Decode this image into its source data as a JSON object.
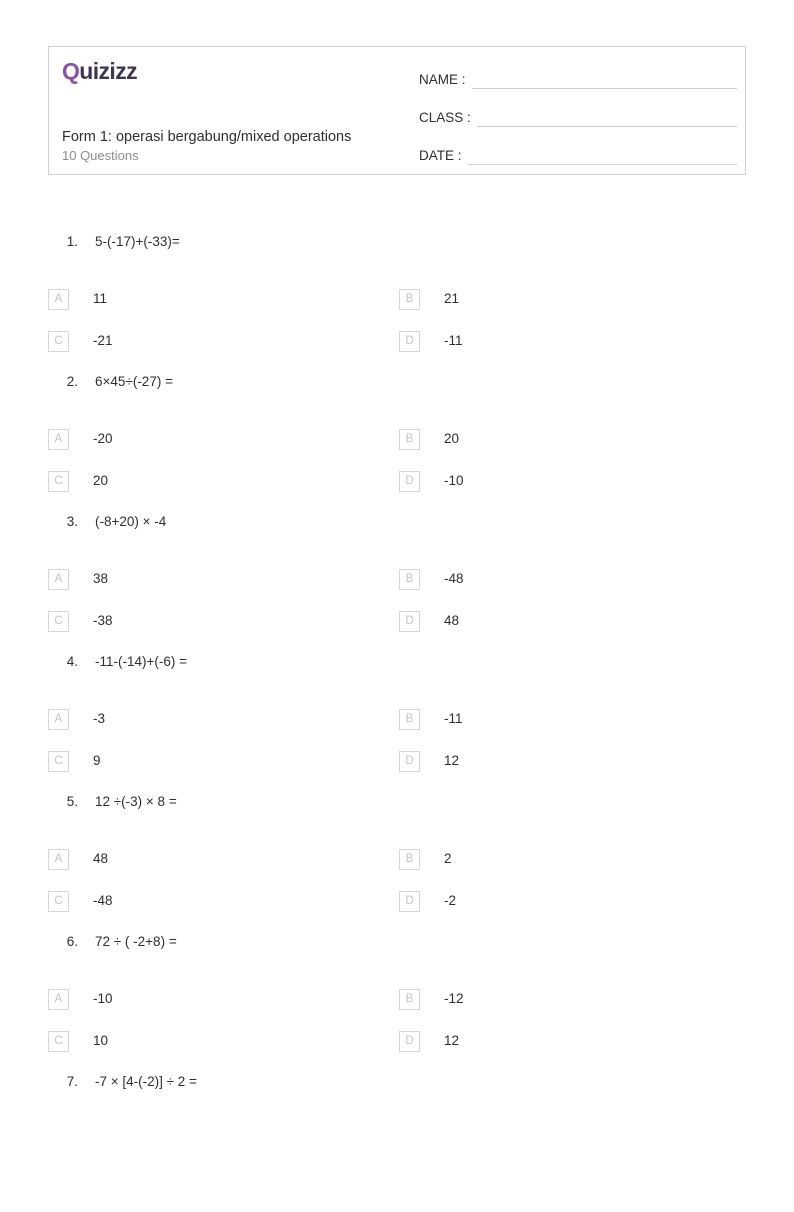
{
  "header": {
    "logo": {
      "first_letter": "Q",
      "rest": "uizizz",
      "accent_color": "#8854a0",
      "text_color": "#3f3551"
    },
    "title": "Form 1: operasi bergabung/mixed operations",
    "subtitle": "10 Questions",
    "fields": [
      {
        "label": "NAME :",
        "value": ""
      },
      {
        "label": "CLASS :",
        "value": ""
      },
      {
        "label": "DATE  :",
        "value": ""
      }
    ]
  },
  "questions": [
    {
      "number": "1.",
      "text": "5-(-17)+(-33)=",
      "options": [
        {
          "letter": "A",
          "text": "11"
        },
        {
          "letter": "B",
          "text": "21"
        },
        {
          "letter": "C",
          "text": "-21"
        },
        {
          "letter": "D",
          "text": "-11"
        }
      ]
    },
    {
      "number": "2.",
      "text": "6×45÷(-27) =",
      "options": [
        {
          "letter": "A",
          "text": "-20"
        },
        {
          "letter": "B",
          "text": "20"
        },
        {
          "letter": "C",
          "text": "20"
        },
        {
          "letter": "D",
          "text": "-10"
        }
      ]
    },
    {
      "number": "3.",
      "text": "(-8+20) × -4",
      "options": [
        {
          "letter": "A",
          "text": "38"
        },
        {
          "letter": "B",
          "text": "-48"
        },
        {
          "letter": "C",
          "text": "-38"
        },
        {
          "letter": "D",
          "text": "48"
        }
      ]
    },
    {
      "number": "4.",
      "text": "-11-(-14)+(-6) =",
      "options": [
        {
          "letter": "A",
          "text": "-3"
        },
        {
          "letter": "B",
          "text": "-11"
        },
        {
          "letter": "C",
          "text": "9"
        },
        {
          "letter": "D",
          "text": "12"
        }
      ]
    },
    {
      "number": "5.",
      "text": "12 ÷(-3) × 8 =",
      "options": [
        {
          "letter": "A",
          "text": "48"
        },
        {
          "letter": "B",
          "text": "2"
        },
        {
          "letter": "C",
          "text": "-48"
        },
        {
          "letter": "D",
          "text": "-2"
        }
      ]
    },
    {
      "number": "6.",
      "text": "72 ÷ ( -2+8) =",
      "options": [
        {
          "letter": "A",
          "text": "-10"
        },
        {
          "letter": "B",
          "text": "-12"
        },
        {
          "letter": "C",
          "text": "10"
        },
        {
          "letter": "D",
          "text": "12"
        }
      ]
    },
    {
      "number": "7.",
      "text": "-7 × [4-(-2)] ÷ 2 =",
      "options": []
    }
  ]
}
